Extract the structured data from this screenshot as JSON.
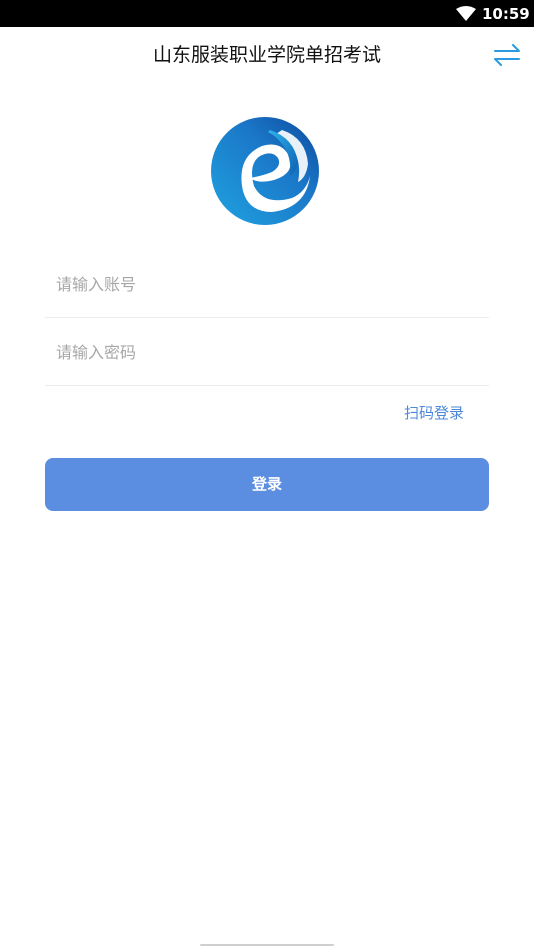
{
  "status_bar": {
    "time": "10:59",
    "wifi_icon": "wifi-icon"
  },
  "header": {
    "title": "山东服装职业学院单招考试",
    "switch_icon": "swap-arrows-icon",
    "accent_color": "#2a9be0"
  },
  "logo": {
    "icon": "e-logo-icon"
  },
  "form": {
    "account_placeholder": "请输入账号",
    "account_value": "",
    "password_placeholder": "请输入密码",
    "password_value": "",
    "scan_login_label": "扫码登录",
    "login_button_label": "登录",
    "button_color": "#5b8de0",
    "link_color": "#4b88d9"
  }
}
